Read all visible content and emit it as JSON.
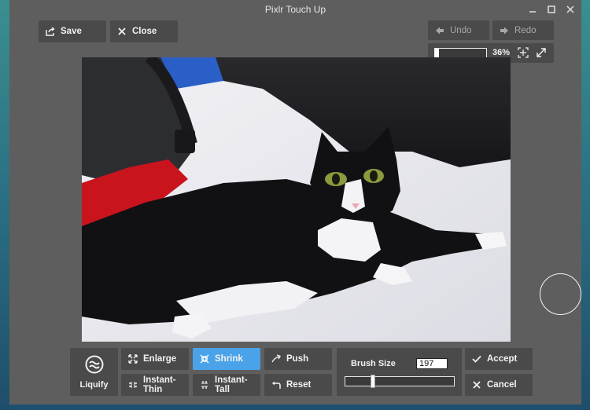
{
  "window": {
    "title": "Pixlr Touch Up"
  },
  "toolbar": {
    "save_label": "Save",
    "close_label": "Close",
    "undo_label": "Undo",
    "redo_label": "Redo"
  },
  "zoom": {
    "percent_text": "36%",
    "level": 0.36
  },
  "tools": {
    "main_label": "Liquify",
    "enlarge_label": "Enlarge",
    "shrink_label": "Shrink",
    "push_label": "Push",
    "instant_thin_label": "Instant-Thin",
    "instant_tall_label": "Instant-Tall",
    "reset_label": "Reset",
    "active_tool": "Shrink"
  },
  "brush": {
    "label": "Brush Size",
    "value": "197",
    "level": 0.24
  },
  "actions": {
    "accept_label": "Accept",
    "cancel_label": "Cancel"
  },
  "colors": {
    "active_tool": "#4aa3e8",
    "button_bg": "#4a4a4a",
    "window_bg": "#5e5e5e"
  },
  "icons": {
    "save": "export-icon",
    "close": "close-icon",
    "undo": "arrow-left-icon",
    "redo": "arrow-right-icon",
    "fit": "fit-screen-icon",
    "fullscreen": "expand-icon",
    "liquify": "waves-icon",
    "enlarge": "enlarge-icon",
    "shrink": "shrink-icon",
    "push": "push-icon",
    "instant_thin": "thin-icon",
    "instant_tall": "tall-icon",
    "reset": "undo-icon",
    "accept": "check-icon",
    "cancel": "close-icon"
  }
}
